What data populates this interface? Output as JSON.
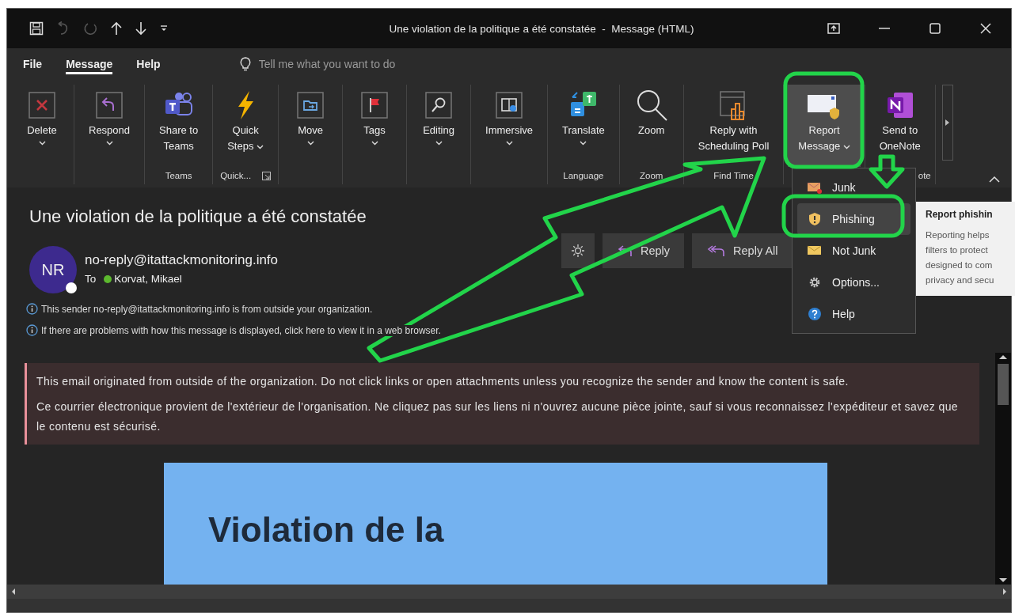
{
  "window": {
    "title": "Une violation de la politique a été constatée  -  Message (HTML)"
  },
  "quick_access": [
    {
      "kind": "save",
      "disabled": false
    },
    {
      "kind": "undo",
      "disabled": true
    },
    {
      "kind": "redo",
      "disabled": true
    },
    {
      "kind": "up",
      "disabled": false
    },
    {
      "kind": "down",
      "disabled": false
    },
    {
      "kind": "customize",
      "disabled": false
    }
  ],
  "menu_tabs": [
    {
      "label": "File",
      "selected": false
    },
    {
      "label": "Message",
      "selected": true
    },
    {
      "label": "Help",
      "selected": false
    }
  ],
  "search": {
    "placeholder": "Tell me what you want to do"
  },
  "ribbon": {
    "groups": [
      {
        "launcher": false,
        "buttons": [
          {
            "kind": "delete",
            "label_lines": [
              "Delete"
            ],
            "dropdown": true,
            "pressed": false
          }
        ]
      },
      {
        "launcher": false,
        "buttons": [
          {
            "kind": "respond",
            "label_lines": [
              "Respond"
            ],
            "dropdown": true,
            "pressed": false
          }
        ]
      },
      {
        "label": "Teams",
        "launcher": false,
        "buttons": [
          {
            "kind": "teams",
            "label_lines": [
              "Share to",
              "Teams"
            ],
            "dropdown": false,
            "pressed": false
          }
        ]
      },
      {
        "label": "Quick...",
        "launcher": true,
        "buttons": [
          {
            "kind": "quick_steps",
            "label_lines": [
              "Quick",
              "Steps"
            ],
            "dropdown": true,
            "pressed": false
          }
        ]
      },
      {
        "launcher": false,
        "buttons": [
          {
            "kind": "move",
            "label_lines": [
              "Move"
            ],
            "dropdown": true,
            "pressed": false
          }
        ]
      },
      {
        "launcher": false,
        "buttons": [
          {
            "kind": "tags",
            "label_lines": [
              "Tags"
            ],
            "dropdown": true,
            "pressed": false
          }
        ]
      },
      {
        "launcher": false,
        "buttons": [
          {
            "kind": "editing",
            "label_lines": [
              "Editing"
            ],
            "dropdown": true,
            "pressed": false
          }
        ]
      },
      {
        "launcher": false,
        "buttons": [
          {
            "kind": "immersive",
            "label_lines": [
              "Immersive"
            ],
            "dropdown": true,
            "pressed": false
          }
        ]
      },
      {
        "label": "Language",
        "launcher": false,
        "buttons": [
          {
            "kind": "translate",
            "label_lines": [
              "Translate"
            ],
            "dropdown": true,
            "pressed": false
          }
        ]
      },
      {
        "label": "Zoom",
        "launcher": false,
        "buttons": [
          {
            "kind": "zoom",
            "label_lines": [
              "Zoom"
            ],
            "dropdown": false,
            "pressed": false
          }
        ]
      },
      {
        "label": "Find Time",
        "launcher": false,
        "buttons": [
          {
            "kind": "poll",
            "label_lines": [
              "Reply with",
              "Scheduling Poll"
            ],
            "dropdown": false,
            "pressed": false
          }
        ]
      },
      {
        "launcher": false,
        "buttons": [
          {
            "kind": "report",
            "label_lines": [
              "Report",
              "Message"
            ],
            "dropdown": true,
            "pressed": true
          }
        ]
      },
      {
        "label": "ote",
        "launcher": false,
        "buttons": [
          {
            "kind": "onenote",
            "label_lines": [
              "Send to",
              "OneNote"
            ],
            "dropdown": false,
            "pressed": false
          }
        ]
      }
    ]
  },
  "message": {
    "subject": "Une violation de la politique a été constatée",
    "sender": {
      "initials": "NR",
      "address": "no-reply@itattackmonitoring.info",
      "online": false
    },
    "to_label": "To",
    "recipients": [
      {
        "name": "Korvat, Mikael",
        "online": true
      }
    ],
    "info_lines": [
      "This sender no-reply@itattackmonitoring.info is from outside your organization.",
      "If there are problems with how this message is displayed, click here to view it in a web browser."
    ],
    "actions": [
      {
        "kind": "theme"
      },
      {
        "kind": "reply",
        "label": "Reply"
      },
      {
        "kind": "reply_all",
        "label": "Reply All"
      }
    ],
    "banner": [
      "This email originated from outside of the organization. Do not click links or open attachments unless you recognize the sender and know the content is safe.",
      "Ce courrier électronique provient de l'extérieur de l'organisation. Ne cliquez pas sur les liens ni n'ouvrez aucune pièce jointe, sauf si vous reconnaissez l'expéditeur et savez que le contenu est sécurisé."
    ],
    "body": {
      "heading": "Violation de la"
    }
  },
  "report_menu": [
    {
      "kind": "junk",
      "label": "Junk",
      "selected": false
    },
    {
      "kind": "phishing",
      "label": "Phishing",
      "selected": true
    },
    {
      "kind": "not_junk",
      "label": "Not Junk",
      "selected": false
    },
    {
      "kind": "options",
      "label": "Options...",
      "selected": false
    },
    {
      "kind": "help",
      "label": "Help",
      "selected": false
    }
  ],
  "tooltip": {
    "title": "Report phishin",
    "lines": [
      "Reporting helps",
      "filters to protect",
      "designed to com",
      "privacy and secu"
    ]
  },
  "annotations": [
    {
      "kind": "report_frame"
    },
    {
      "kind": "phishing_frame"
    },
    {
      "kind": "down_arrow"
    },
    {
      "kind": "big_arrow"
    }
  ]
}
